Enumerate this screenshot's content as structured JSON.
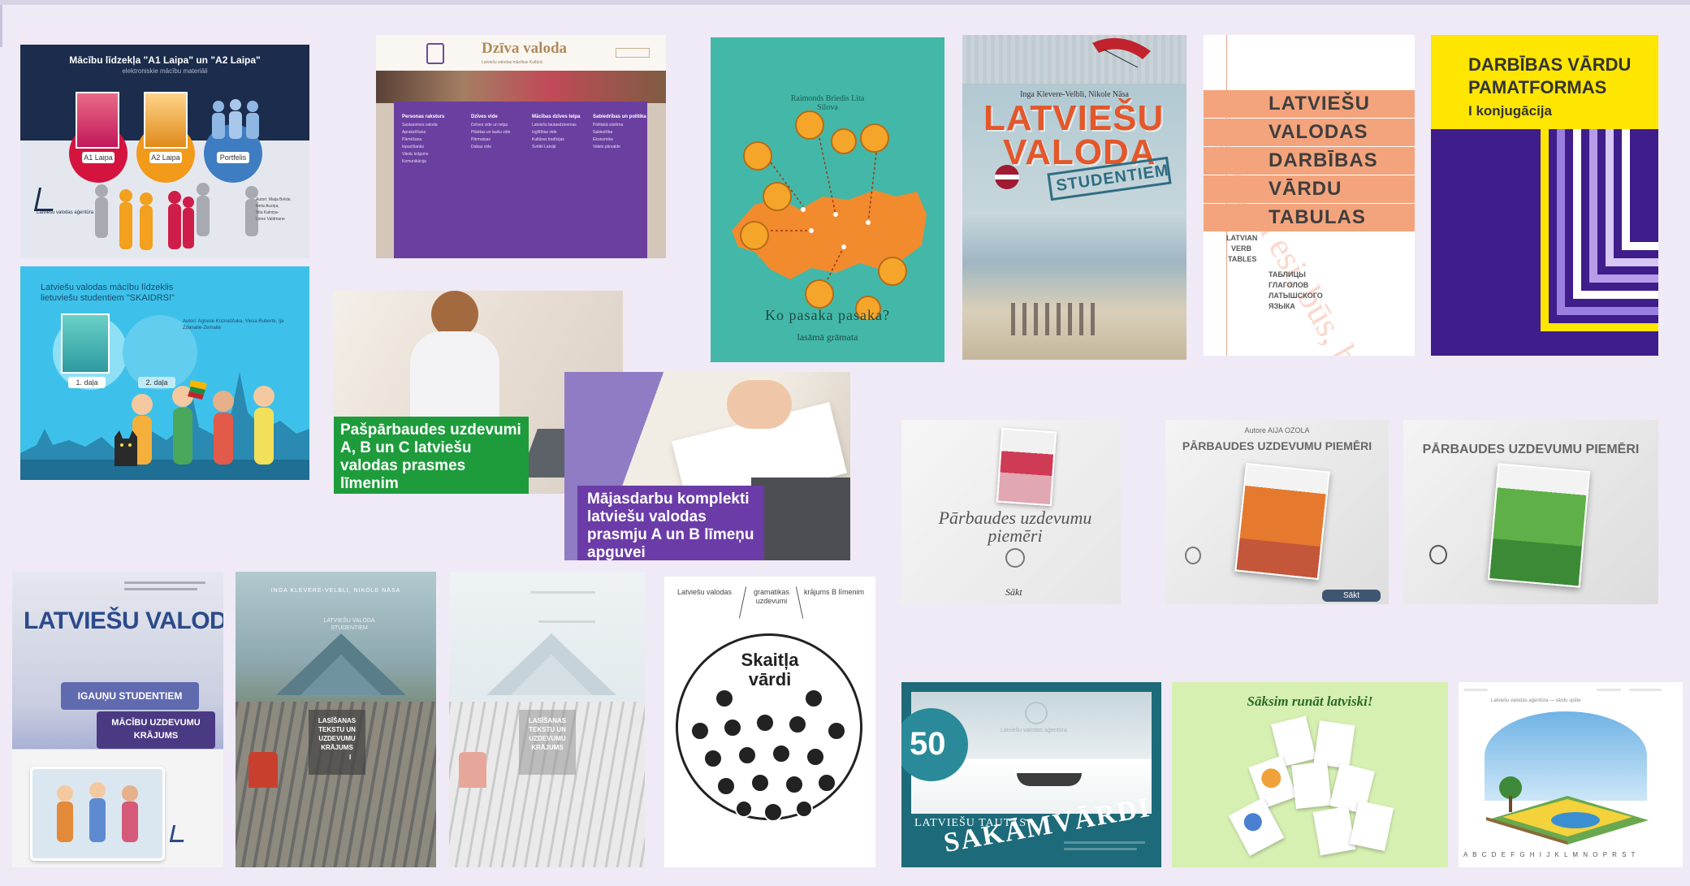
{
  "tiles": {
    "laipa": {
      "heading": "Mācību līdzekļa \"A1 Laipa\" un \"A2 Laipa\"",
      "subheading": "elektroniskie mācību materiāli",
      "btn_a1": "A1 Laipa",
      "btn_a2": "A2 Laipa",
      "btn_3": "Portfelis",
      "logo": "Latviešu valodas aģentūra",
      "authors": [
        "Autori: Maija Brēde,",
        "Iveta Auziņa,",
        "Vita Kalniņa-",
        "Liene Valdmane"
      ]
    },
    "dziva": {
      "title": "Dzīva valoda",
      "subtitle": "Latviešu valodas mācības Kultūrā",
      "columns": [
        {
          "head": "Personas raksturs",
          "items": [
            "Saskarsmes valoda",
            "Aprakstīšana",
            "Pārnēšana",
            "Iepazīšanās",
            "Vārdu krājums",
            "Komunikācija"
          ]
        },
        {
          "head": "Dzīves vide",
          "items": [
            "Dzīves vide un telpa",
            "Pilsētas un lauku vide",
            "Pārmaiņas",
            "Dabas vide"
          ]
        },
        {
          "head": "Mācības dzīves telpa",
          "items": [
            "Latviešu tautasdziesmas",
            "Izglītības vide",
            "Kultūras tradīcijas",
            "Svētki Latvijā"
          ]
        },
        {
          "head": "Sabiedrības un politika",
          "items": [
            "Politiskā sistēma",
            "Sabiedrība",
            "Ekonomika",
            "Valsts pārvalde"
          ]
        }
      ]
    },
    "pasaka": {
      "authors": "Raimonds Briedis Lita Silova",
      "title": "Ko pasaka pasaka?",
      "subtitle": "lasāmā grāmata"
    },
    "studentiem": {
      "authors": "Inga Klevere-Velbli, Nikole Nāsa",
      "title1": "LATVIEŠU",
      "title2": "VALODA",
      "stamp": "STUDENTIEM"
    },
    "verb_tables": {
      "lines": [
        "LATVIEŠU",
        "VALODAS",
        "DARBĪBAS",
        "VĀRDU",
        "TABULAS"
      ],
      "en": [
        "LATVIAN",
        "VERB",
        "TABLES"
      ],
      "ru": [
        "ТАБЛИЦЫ",
        "ГЛАГОЛОВ",
        "ЛАТЫШСКОГО",
        "ЯЗЫКА"
      ],
      "bg": "es esmu, tu esi, būs, bija"
    },
    "pamatformas": {
      "line1": "DARBĪBAS VĀRDU",
      "line2": "PAMATFORMAS",
      "line3": "I konjugācija"
    },
    "skaidrs": {
      "heading": "Latviešu valodas mācību līdzeklis lietuviešu studentiem \"SKAIDRS!\"",
      "part1": "1. daļa",
      "part2": "2. daļa",
      "authors": "Autori: Agnese Koziraščuka, Viesa Ruberte, Ija Zdanaite-Zemaite"
    },
    "parbaudes_abc": {
      "label": "Pašpārbaudes uzdevumi A, B un C latviešu valodas prasmes līmenim"
    },
    "majasdarbu": {
      "label": "Mājasdarbu komplekti latviešu valodas prasmju A un B līmeņu apguvei"
    },
    "piemeri1": {
      "title": "Pārbaudes uzdevumu piemēri",
      "button": "Sākt"
    },
    "piemeri2": {
      "author": "Autore AIJA OZOLA",
      "title": "PĀRBAUDES UZDEVUMU PIEMĒRI",
      "button": "Sākt"
    },
    "piemeri3": {
      "title": "PĀRBAUDES UZDEVUMU PIEMĒRI"
    },
    "igaunu": {
      "title": "LATVIEŠU VALODA",
      "band1": "IGAUŅU STUDENTIEM",
      "band2": "MĀCĪBU UZDEVUMU KRĀJUMS"
    },
    "lasisanas": {
      "authors": "INGA KLEVERE-VELBLI, NIKOLE NĀSA",
      "subtitle": "LATVIEŠU VALODA STUDENTIEM",
      "box": "LASĪŠANAS TEKSTU UN UZDEVUMU KRĀJUMS",
      "box_num": "I"
    },
    "lasisanas2": {
      "box": "LASĪŠANAS TEKSTU UN UZDEVUMU KRĀJUMS"
    },
    "skaitla": {
      "top1": "Latviešu valodas",
      "top2": "gramatikas uzdevumi",
      "top3": "krājums B līmenim",
      "title1": "Skaitļa",
      "title2": "vārdi"
    },
    "sakamvardi": {
      "number": "50",
      "line1": "LATVIEŠU TAUTAS",
      "line2": "SAKĀMVĀRDI",
      "small": "Latviešu valodas aģentūra"
    },
    "runat": {
      "title": "Sāksim runāt latviski!"
    },
    "book3d": {
      "header": "Latviešu valodas aģentūra — vārdu spēle",
      "alphabet": "A B C D E F G H I J K L M N O P R S T"
    }
  }
}
